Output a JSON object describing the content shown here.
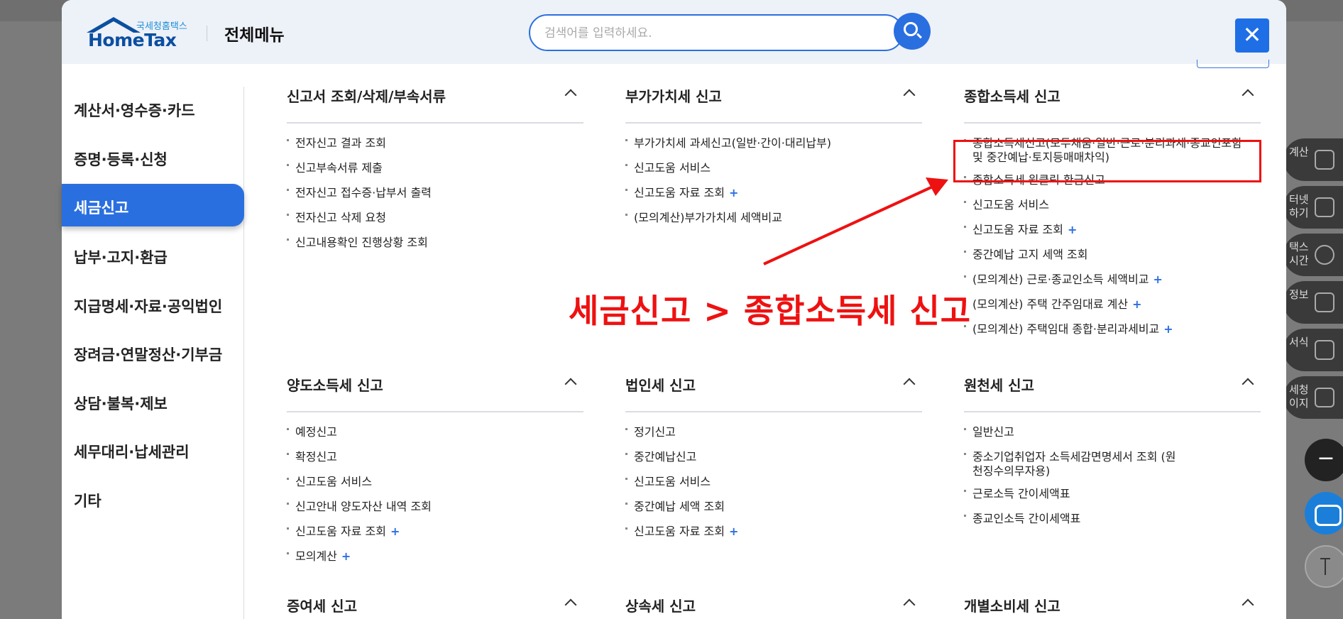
{
  "header": {
    "logo_small": "국세청홈택스",
    "logo_big": "HomeTax",
    "title": "전체메뉴",
    "search_placeholder": "검색어를 입력하세요.",
    "close_label": "✕"
  },
  "sidebar": {
    "items": [
      {
        "label": "계산서·영수증·카드"
      },
      {
        "label": "증명·등록·신청"
      },
      {
        "label": "세금신고",
        "active": true
      },
      {
        "label": "납부·고지·환급"
      },
      {
        "label": "지급명세·자료·공익법인"
      },
      {
        "label": "장려금·연말정산·기부금"
      },
      {
        "label": "상담·불복·제보"
      },
      {
        "label": "세무대리·납세관리"
      },
      {
        "label": "기타"
      }
    ]
  },
  "sections": [
    {
      "title": "신고서 조회/삭제/부속서류",
      "items": [
        {
          "label": "전자신고 결과 조회"
        },
        {
          "label": "신고부속서류 제출"
        },
        {
          "label": "전자신고 접수증·납부서 출력"
        },
        {
          "label": "전자신고 삭제 요청"
        },
        {
          "label": "신고내용확인 진행상황 조회"
        }
      ]
    },
    {
      "title": "부가가치세 신고",
      "items": [
        {
          "label": "부가가치세 과세신고(일반·간이·대리납부)"
        },
        {
          "label": "신고도움 서비스"
        },
        {
          "label": "신고도움 자료 조회",
          "plus": "+"
        },
        {
          "label": "(모의계산)부가가치세 세액비교"
        }
      ]
    },
    {
      "title": "종합소득세 신고",
      "items": [
        {
          "label": "종합소득세신고(모두채움·일반·근로·분리과세·종교인포함 및 중간예납·토지등매매차익)"
        },
        {
          "label": "종합소득세 원클릭 환급신고"
        },
        {
          "label": "신고도움 서비스"
        },
        {
          "label": "신고도움 자료 조회",
          "plus": "+"
        },
        {
          "label": "중간예납 고지 세액 조회"
        },
        {
          "label": "(모의계산) 근로·종교인소득 세액비교",
          "plus": "+"
        },
        {
          "label": "(모의계산) 주택 간주임대료 계산",
          "plus": "+"
        },
        {
          "label": "(모의계산) 주택임대 종합·분리과세비교",
          "plus": "+"
        }
      ]
    },
    {
      "title": "양도소득세 신고",
      "items": [
        {
          "label": "예정신고"
        },
        {
          "label": "확정신고"
        },
        {
          "label": "신고도움 서비스"
        },
        {
          "label": "신고안내 양도자산 내역 조회"
        },
        {
          "label": "신고도움 자료 조회",
          "plus": "+"
        },
        {
          "label": "모의계산",
          "plus": "+"
        }
      ]
    },
    {
      "title": "법인세 신고",
      "items": [
        {
          "label": "정기신고"
        },
        {
          "label": "중간예납신고"
        },
        {
          "label": "신고도움 서비스"
        },
        {
          "label": "중간예납 세액 조회"
        },
        {
          "label": "신고도움 자료 조회",
          "plus": "+"
        }
      ]
    },
    {
      "title": "원천세 신고",
      "items": [
        {
          "label": "일반신고"
        },
        {
          "label": "중소기업취업자 소득세감면명세서 조회 (원천징수의무자용)"
        },
        {
          "label": "근로소득 간이세액표"
        },
        {
          "label": "종교인소득 간이세액표"
        }
      ]
    },
    {
      "title": "증여세 신고",
      "items": []
    },
    {
      "title": "상속세 신고",
      "items": []
    },
    {
      "title": "개별소비세 신고",
      "items": []
    }
  ],
  "annotation": {
    "text": "세금신고 > 종합소득세 신고",
    "color": "#ee1111"
  },
  "right_rail": [
    {
      "label": "계산"
    },
    {
      "label": "터넷\n하기"
    },
    {
      "label": "택스\n시간"
    },
    {
      "label": "정보"
    },
    {
      "label": "서식"
    },
    {
      "label": "세청\n이지"
    }
  ],
  "colors": {
    "accent": "#2a6fe0",
    "annotation": "#ee1111"
  }
}
